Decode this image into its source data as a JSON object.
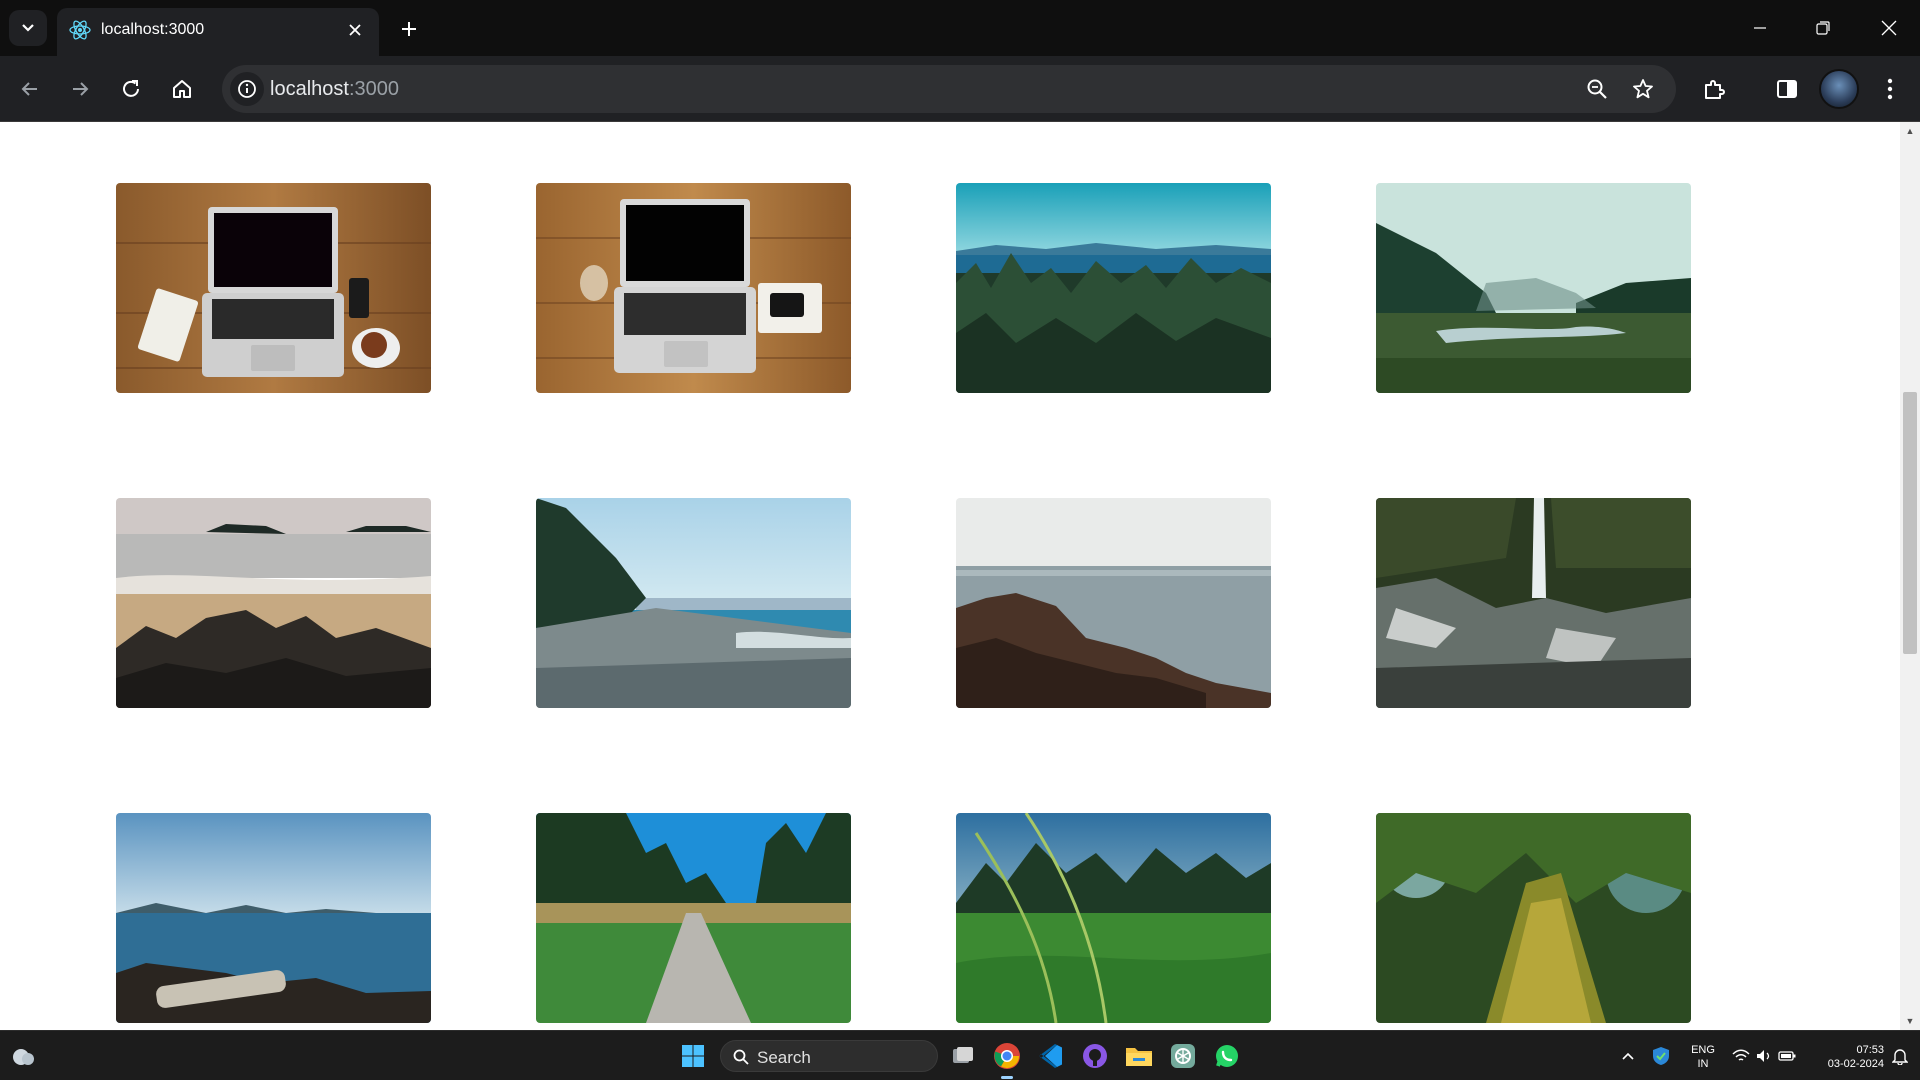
{
  "browser": {
    "tab": {
      "title": "localhost:3000",
      "icon": "react-icon"
    },
    "address": {
      "host": "localhost",
      "port": ":3000"
    }
  },
  "gallery": {
    "photos": [
      {
        "name": "laptop-desk-coffee"
      },
      {
        "name": "laptop-desk-phone-glass"
      },
      {
        "name": "forest-lake-view"
      },
      {
        "name": "misty-valley-river"
      },
      {
        "name": "beach-rocks-islands"
      },
      {
        "name": "pebble-shore-trees"
      },
      {
        "name": "rocky-coast-sea"
      },
      {
        "name": "waterfall-rocks"
      },
      {
        "name": "lake-driftwood"
      },
      {
        "name": "forest-path"
      },
      {
        "name": "grass-closeup"
      },
      {
        "name": "mossy-tree-trunk"
      }
    ]
  },
  "taskbar": {
    "search_label": "Search",
    "lang_line1": "ENG",
    "lang_line2": "IN",
    "time": "07:53",
    "date": "03-02-2024"
  },
  "colors": {
    "titlebar": "#0f0f0f",
    "toolbar": "#202124",
    "omnibox": "#2f3033",
    "taskbar": "#1c1c1c"
  }
}
